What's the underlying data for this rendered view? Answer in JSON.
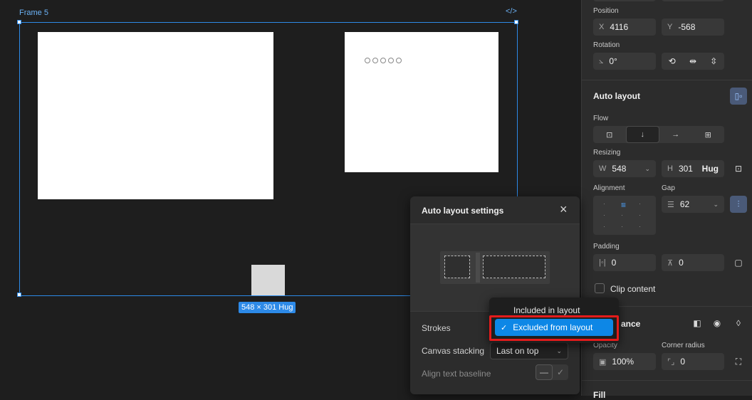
{
  "canvas": {
    "frame_label": "Frame 5",
    "code_icon": "code-icon",
    "size_badge": "548 × 301 Hug",
    "dots_count_label": "○○○○○"
  },
  "panel": {
    "position": {
      "label": "Position",
      "x_prefix": "X",
      "x": "4116",
      "y_prefix": "Y",
      "y": "-568"
    },
    "rotation": {
      "label": "Rotation",
      "value": "0°"
    },
    "auto_layout": {
      "title": "Auto layout",
      "flow_label": "Flow",
      "resizing_label": "Resizing",
      "w_prefix": "W",
      "w": "548",
      "h_prefix": "H",
      "h": "301",
      "h_mode": "Hug",
      "alignment_label": "Alignment",
      "gap_label": "Gap",
      "gap": "62",
      "padding_label": "Padding",
      "padding_h": "0",
      "padding_v": "0",
      "clip_label": "Clip content"
    },
    "appearance": {
      "title_partial": "ance",
      "opacity_label": "Opacity",
      "opacity": "100%",
      "radius_label": "Corner radius",
      "radius": "0"
    },
    "fill_partial": "Fill"
  },
  "popup": {
    "title": "Auto layout settings",
    "strokes_label": "Strokes",
    "stacking_label": "Canvas stacking",
    "stacking_value": "Last on top",
    "baseline_label": "Align text baseline"
  },
  "menu": {
    "item_included": "Included in layout",
    "item_excluded": "Excluded from layout"
  },
  "colors": {
    "accent": "#0d87e6",
    "highlight": "#e31b1b",
    "selection": "#2d8ae8"
  }
}
